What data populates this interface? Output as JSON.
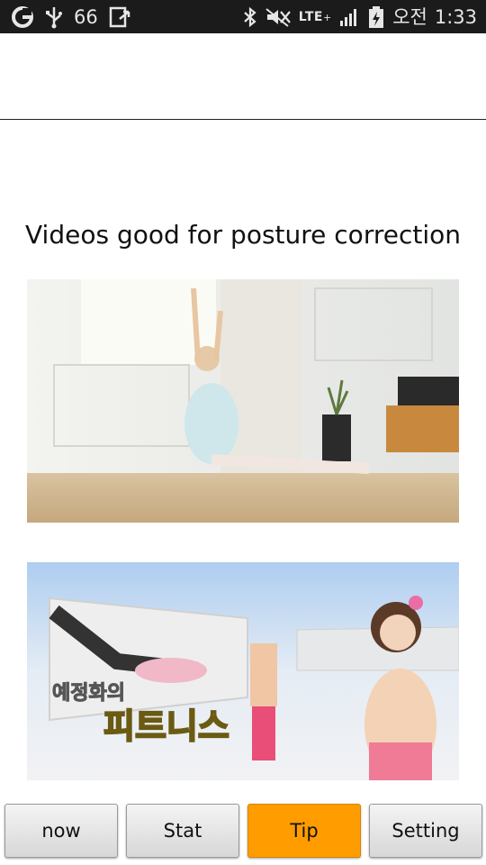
{
  "status_bar": {
    "battery_level_text": "66",
    "network": "LTE",
    "network_sup": "+",
    "time_period": "오전",
    "time": "1:33"
  },
  "main": {
    "title": "Videos good for posture correction",
    "videos": [
      {
        "thumbnail_icon": "ballet-stretch-thumbnail"
      },
      {
        "thumbnail_icon": "fitness-show-thumbnail",
        "caption_line1": "예정화의",
        "caption_line2": "피트니스"
      }
    ]
  },
  "tabs": [
    {
      "label": "now",
      "active": false
    },
    {
      "label": "Stat",
      "active": false
    },
    {
      "label": "Tip",
      "active": true
    },
    {
      "label": "Setting",
      "active": false
    }
  ],
  "colors": {
    "active_tab": "#ff9c00",
    "status_bar": "#1b1b1b"
  }
}
